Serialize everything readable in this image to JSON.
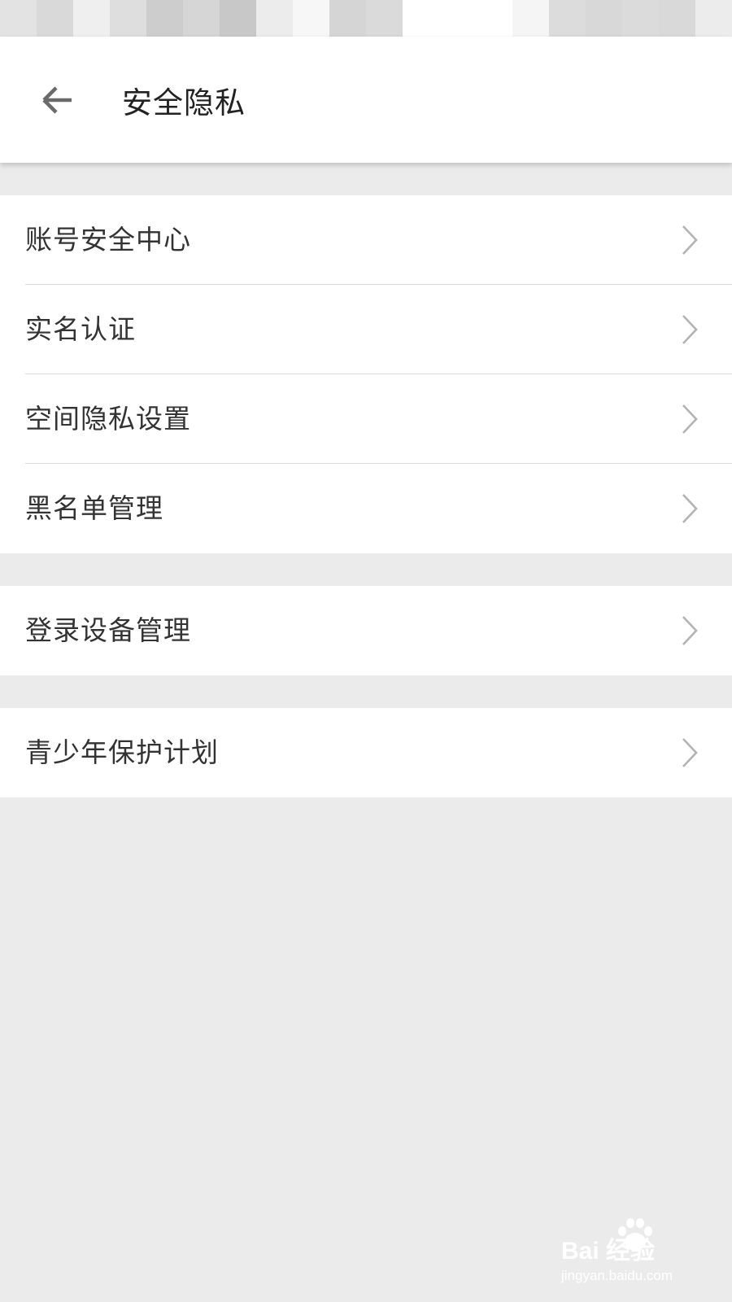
{
  "header": {
    "title": "安全隐私",
    "back_icon": "arrow-left-icon"
  },
  "groups": [
    {
      "items": [
        {
          "label": "账号安全中心"
        },
        {
          "label": "实名认证"
        },
        {
          "label": "空间隐私设置"
        },
        {
          "label": "黑名单管理"
        }
      ]
    },
    {
      "items": [
        {
          "label": "登录设备管理"
        }
      ]
    },
    {
      "items": [
        {
          "label": "青少年保护计划"
        }
      ]
    }
  ],
  "row_icon": "chevron-right-icon",
  "colors": {
    "background": "#ebebeb",
    "surface": "#ffffff",
    "text": "#333333",
    "chevron": "#b3b3b3",
    "divider": "#dcdcdc"
  },
  "watermark": {
    "brand": "Bai 经验",
    "url": "jingyan.baidu.com"
  }
}
